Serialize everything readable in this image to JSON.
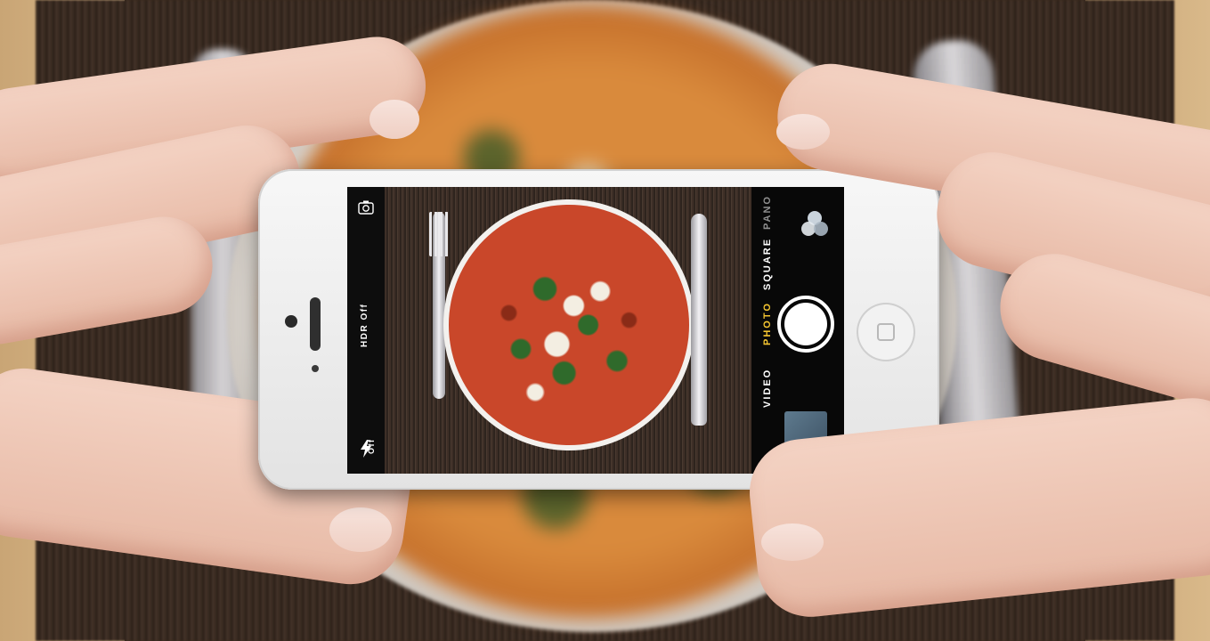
{
  "camera_app": {
    "hdr_label": "HDR Off",
    "flash_label": "Off",
    "modes": [
      {
        "label": "PANO",
        "active": false
      },
      {
        "label": "SQUARE",
        "active": false
      },
      {
        "label": "PHOTO",
        "active": true
      },
      {
        "label": "VIDEO",
        "active": false
      }
    ],
    "icons": {
      "camera_switch": "camera-switch-icon",
      "flash": "flash-icon",
      "filters": "filters-icon"
    },
    "colors": {
      "active_mode": "#f4c531",
      "inactive_mode": "#ffffff",
      "dim_mode": "#8f8f8f"
    }
  }
}
